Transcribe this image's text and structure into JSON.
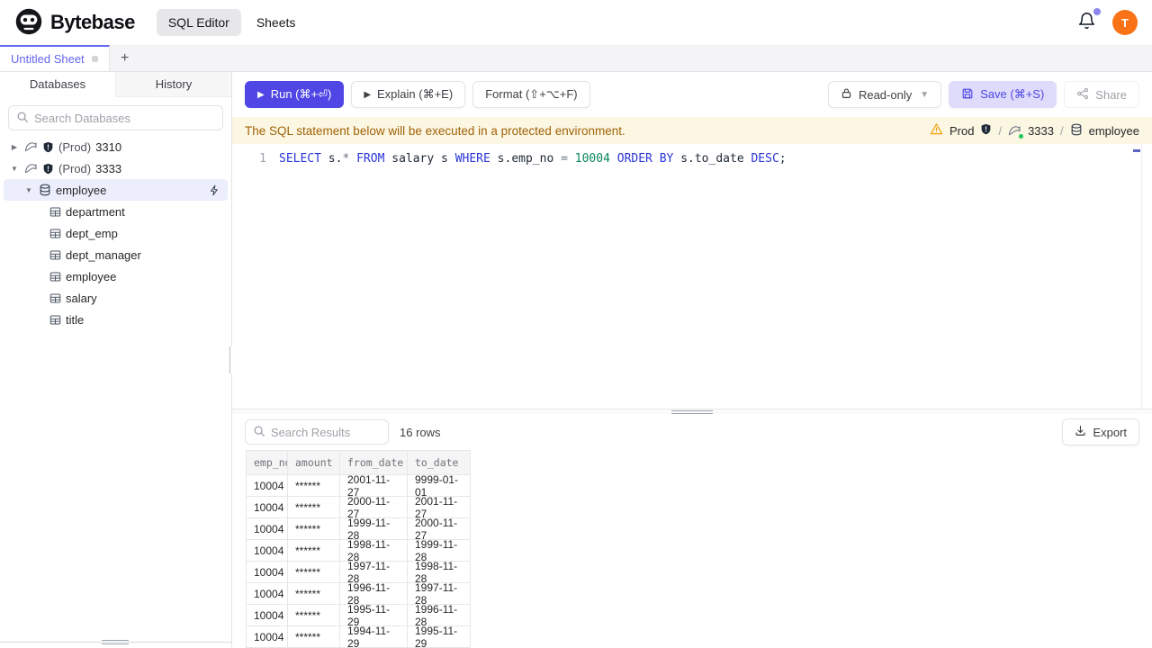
{
  "header": {
    "brand": "Bytebase",
    "nav": [
      {
        "label": "SQL Editor",
        "active": true
      },
      {
        "label": "Sheets",
        "active": false
      }
    ],
    "avatar_initial": "T"
  },
  "tabs": {
    "active_tab": "Untitled Sheet",
    "add_label": "+"
  },
  "sidebar": {
    "tabs": [
      {
        "label": "Databases",
        "active": true
      },
      {
        "label": "History",
        "active": false
      }
    ],
    "search_placeholder": "Search Databases",
    "tree": {
      "instances": [
        {
          "env": "(Prod)",
          "number": "3310",
          "expanded": false
        },
        {
          "env": "(Prod)",
          "number": "3333",
          "expanded": true
        }
      ],
      "database": {
        "name": "employee"
      },
      "tables": [
        "department",
        "dept_emp",
        "dept_manager",
        "employee",
        "salary",
        "title"
      ]
    }
  },
  "toolbar": {
    "run": "Run (⌘+⏎)",
    "explain": "Explain (⌘+E)",
    "format": "Format (⇧+⌥+F)",
    "readonly": "Read-only",
    "save": "Save (⌘+S)",
    "share": "Share"
  },
  "banner": {
    "message": "The SQL statement below will be executed in a protected environment.",
    "environment": "Prod",
    "separator": "/",
    "instance": "3333",
    "database": "employee"
  },
  "editor": {
    "line_number": "1",
    "tokens": [
      {
        "text": "SELECT",
        "type": "kw"
      },
      {
        "text": " s.",
        "type": "id"
      },
      {
        "text": "*",
        "type": "op"
      },
      {
        "text": " ",
        "type": "id"
      },
      {
        "text": "FROM",
        "type": "kw"
      },
      {
        "text": " salary s ",
        "type": "id"
      },
      {
        "text": "WHERE",
        "type": "kw"
      },
      {
        "text": " s.emp_no ",
        "type": "id"
      },
      {
        "text": "=",
        "type": "op"
      },
      {
        "text": " ",
        "type": "id"
      },
      {
        "text": "10004",
        "type": "num"
      },
      {
        "text": " ",
        "type": "id"
      },
      {
        "text": "ORDER BY",
        "type": "kw"
      },
      {
        "text": " s.to_date ",
        "type": "id"
      },
      {
        "text": "DESC",
        "type": "kw"
      },
      {
        "text": ";",
        "type": "id"
      }
    ]
  },
  "results": {
    "search_placeholder": "Search Results",
    "row_count": "16 rows",
    "export_label": "Export",
    "columns": [
      "emp_no",
      "amount",
      "from_date",
      "to_date"
    ],
    "rows": [
      [
        "10004",
        "******",
        "2001-11-27",
        "9999-01-01"
      ],
      [
        "10004",
        "******",
        "2000-11-27",
        "2001-11-27"
      ],
      [
        "10004",
        "******",
        "1999-11-28",
        "2000-11-27"
      ],
      [
        "10004",
        "******",
        "1998-11-28",
        "1999-11-28"
      ],
      [
        "10004",
        "******",
        "1997-11-28",
        "1998-11-28"
      ],
      [
        "10004",
        "******",
        "1996-11-28",
        "1997-11-28"
      ],
      [
        "10004",
        "******",
        "1995-11-29",
        "1996-11-28"
      ],
      [
        "10004",
        "******",
        "1994-11-29",
        "1995-11-29"
      ]
    ]
  },
  "colors": {
    "accent": "#4f46e5",
    "tab_accent": "#6366f1",
    "avatar": "#f97316",
    "badge": "#8c86f2",
    "warning_bg": "#fbf7e3",
    "warning_text": "#a16207",
    "keyword": "#2a35d8",
    "number": "#098658",
    "operator": "#6b7280",
    "code": "#1f2937",
    "selected_bg": "#eceffb"
  }
}
